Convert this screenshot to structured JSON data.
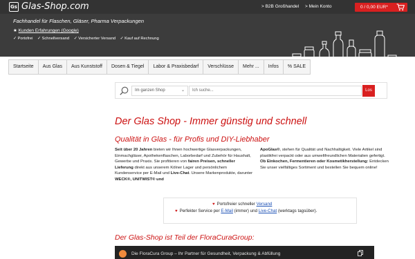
{
  "topbar": {
    "logo_mark": "Gs",
    "logo_text": "Glas-Shop.com",
    "b2b_link": "> B2B Großhandel",
    "account_link": "> Mein Konto",
    "cart_label": "0 / 0,00 EUR*",
    "cart_icon": "shopping-cart-icon",
    "bg_color": "#333333",
    "accent_color": "#d92020"
  },
  "banner": {
    "tagline": "Fachhandel für Flaschen, Gläser, Pharma Verpackungen",
    "reviews_prefix": "★",
    "reviews_link": "Kunden Erfahrungen (Google)",
    "features": [
      "✓ Portofrei",
      "✓ Schnellversand",
      "✓ Versicherter Versand",
      "✓ Kauf auf Rechnung"
    ]
  },
  "nav": {
    "items": [
      "Startseite",
      "Aus Glas",
      "Aus Kunststoff",
      "Dosen & Tiegel",
      "Labor & Praxisbedarf",
      "Verschlüsse",
      "Mehr ...",
      "Infos",
      "% SALE"
    ]
  },
  "search": {
    "scope": "Im ganzen Shop",
    "placeholder": "Ich suche...",
    "button": "Los"
  },
  "content": {
    "headline": "Der Glas Shop - Immer günstig und schnell",
    "subheadline": "Qualität in Glas - für Profis und DIY-Liebhaber",
    "left_col": {
      "p1_bold": "Seit über 20 Jahren",
      "p1_a": " bieten wir Ihnen hochwertige Glasverpackungen, Einmachgläser, Apothekenflaschen, Laborbedarf und Zubehör für Haushalt, Gewerbe und Praxis. Sie profitieren von ",
      "p1_bold2": "fairen Preisen, schneller Lieferung",
      "p1_b": " direkt aus unserem Kölner Lager und persönlichem Kundenservice per E-Mail und ",
      "p1_bold3": "Live-Chat",
      "p1_c": ". Unsere Markenprodukte, darunter ",
      "p1_bold4": "WECK®, UNITWIST® und"
    },
    "right_col": {
      "p_bold": "ApoGlas®",
      "p_a": ", stehen für Qualität und Nachhaltigkeit. Viele Artikel sind plastikfrei verpackt oder aus umweltfreundlichen Materialien gefertigt.",
      "p_bold2": "Ob Einkochen, Fermentieren oder Kosmetikherstellung:",
      "p_b": " Entdecken Sie unser vielfältiges Sortiment und bestellen Sie bequem online!"
    },
    "benefits": {
      "b1_text": "Portofreier schneller ",
      "b1_link": "Versand",
      "b2_text": "Perfekter Service per ",
      "b2_link1": "E-Mail",
      "b2_mid": " (immer) und ",
      "b2_link2": "Live-Chat",
      "b2_tail": " (werktags tagsüber)."
    },
    "group_title": "Der Glas-Shop ist Teil der FloraCuraGroup:",
    "video_title": "Die FloraCura Group – Ihr Partner für Gesundheit, Verpackung & Abfüllung"
  }
}
